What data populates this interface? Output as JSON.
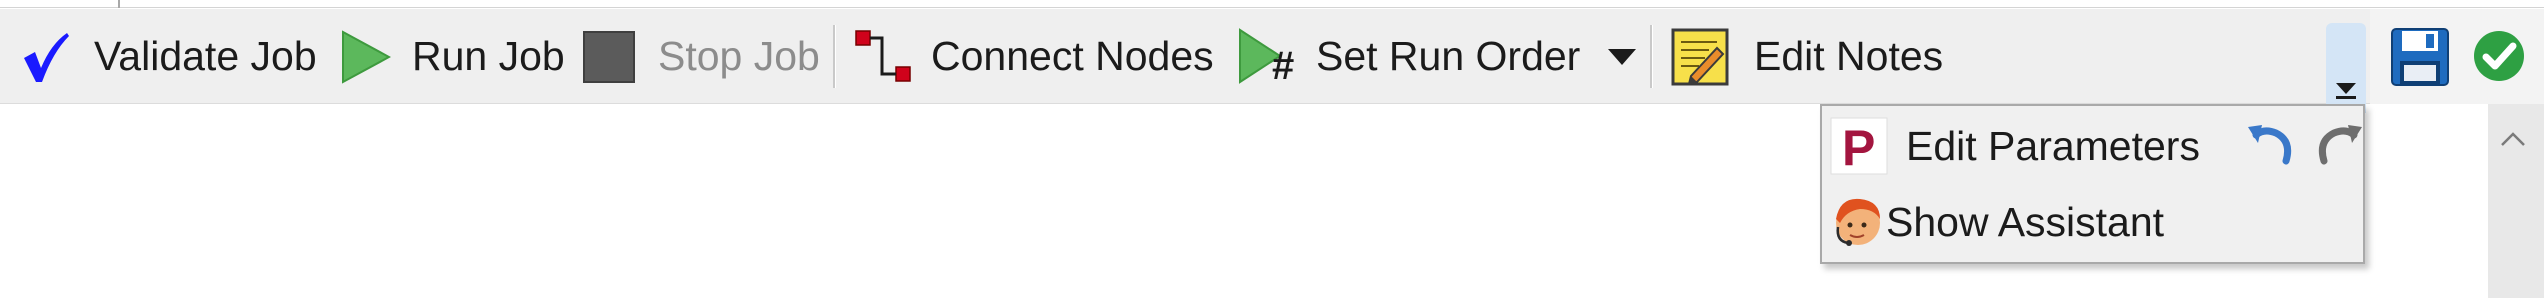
{
  "toolbar": {
    "validate_label": "Validate Job",
    "run_label": "Run Job",
    "stop_label": "Stop Job",
    "connect_label": "Connect Nodes",
    "run_order_label": "Set Run Order",
    "notes_label": "Edit Notes"
  },
  "overflow_menu": {
    "parameters_label": "Edit Parameters",
    "parameters_icon_letter": "P",
    "assistant_label": "Show Assistant"
  },
  "run_order_icon_symbol": "#",
  "colors": {
    "toolbar_bg": "#efefef",
    "validate_check": "#1a1aff",
    "run_green": "#5cb85c",
    "stop_gray": "#5b5b5b",
    "connect_red": "#d0021b",
    "save_blue": "#1e6bbf",
    "ok_green": "#2ea043",
    "param_icon_red": "#a3153f",
    "undo_blue": "#3a78c9",
    "overflow_highlight": "#d4e5f6"
  },
  "icons": {
    "validate": "blue-checkmark-icon",
    "run": "green-play-icon",
    "stop": "gray-square-icon",
    "connect": "node-connector-icon",
    "run_order": "play-hash-icon",
    "notes": "notepad-pencil-icon",
    "overflow": "chevron-down-icon",
    "save": "floppy-disk-icon",
    "ok": "green-check-circle-icon",
    "parameters": "p-square-icon",
    "undo": "undo-arrow-icon",
    "redo": "redo-arrow-icon",
    "assistant": "assistant-avatar-icon",
    "scroll_up": "chevron-up-icon"
  }
}
